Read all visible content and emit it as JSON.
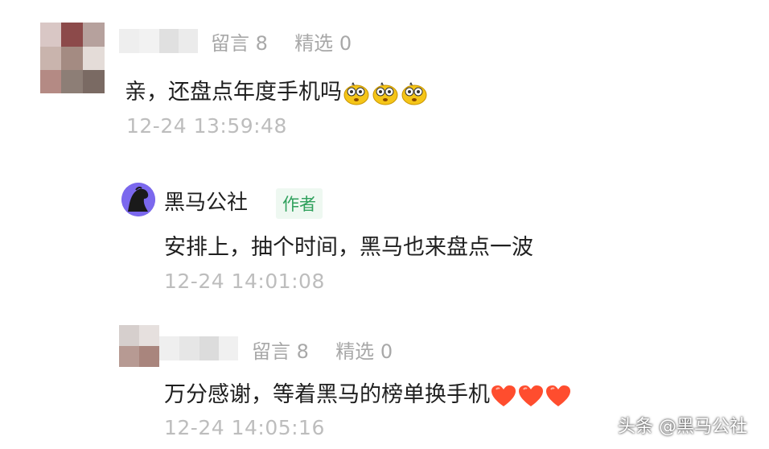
{
  "comments": [
    {
      "meta": {
        "messages": "留言 8",
        "featured": "精选 0"
      },
      "text": "亲，还盘点年度手机吗",
      "emoji": [
        "face-emoji",
        "face-emoji",
        "face-emoji"
      ],
      "time": "12-24 13:59:48"
    },
    {
      "author": {
        "name": "黑马公社",
        "badge": "作者"
      },
      "text": "安排上，抽个时间，黑马也来盘点一波",
      "time": "12-24 14:01:08"
    },
    {
      "meta": {
        "messages": "留言 8",
        "featured": "精选 0"
      },
      "text": "万分感谢，等着黑马的榜单换手机",
      "emoji": [
        "heart-emoji",
        "heart-emoji",
        "heart-emoji"
      ],
      "time": "12-24 14:05:16"
    }
  ],
  "watermark": "头条 @黑马公社",
  "colors": {
    "time": "#bdbdbd",
    "meta": "#a8a8a8",
    "badge_bg": "#eef8f1",
    "badge_text": "#2fa05c",
    "heart": "#ff4d2e",
    "emoji_face": "#f5c518"
  }
}
